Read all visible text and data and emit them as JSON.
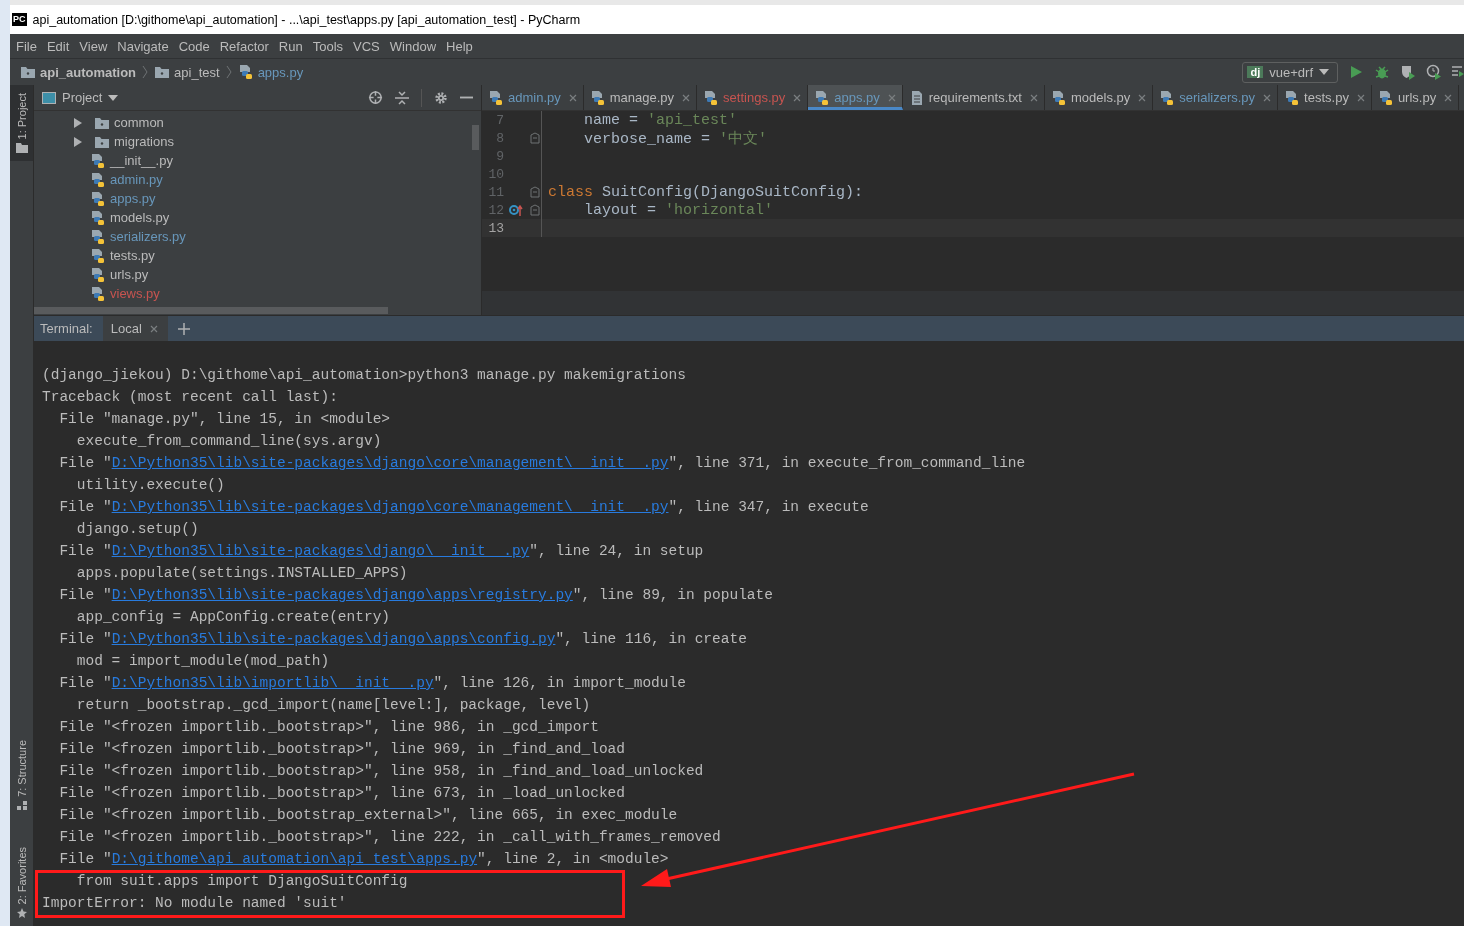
{
  "window": {
    "app_icon_text": "PC",
    "title": "api_automation [D:\\githome\\api_automation] - ...\\api_test\\apps.py [api_automation_test] - PyCharm"
  },
  "menu": [
    "File",
    "Edit",
    "View",
    "Navigate",
    "Code",
    "Refactor",
    "Run",
    "Tools",
    "VCS",
    "Window",
    "Help"
  ],
  "breadcrumb": [
    {
      "label": "api_automation",
      "kind": "folder"
    },
    {
      "label": "api_test",
      "kind": "folder"
    },
    {
      "label": "apps.py",
      "kind": "python"
    }
  ],
  "run_config": {
    "icon_text": "dj",
    "label": "vue+drf"
  },
  "tool_strip": {
    "top": [
      {
        "label": "1: Project",
        "selected": true
      }
    ],
    "bottom": [
      {
        "label": "7: Structure",
        "selected": false
      },
      {
        "label": "2: Favorites",
        "selected": false
      }
    ]
  },
  "project": {
    "title": "Project",
    "items": [
      {
        "name": "common",
        "kind": "folder",
        "expanded": false,
        "color": "#bbbbbb"
      },
      {
        "name": "migrations",
        "kind": "folder",
        "expanded": false,
        "color": "#bbbbbb"
      },
      {
        "name": "__init__.py",
        "kind": "python",
        "color": "#bbbbbb"
      },
      {
        "name": "admin.py",
        "kind": "python",
        "color": "#6897bb"
      },
      {
        "name": "apps.py",
        "kind": "python",
        "color": "#6897bb"
      },
      {
        "name": "models.py",
        "kind": "python",
        "color": "#bbbbbb"
      },
      {
        "name": "serializers.py",
        "kind": "python",
        "color": "#6897bb"
      },
      {
        "name": "tests.py",
        "kind": "python",
        "color": "#bbbbbb"
      },
      {
        "name": "urls.py",
        "kind": "python",
        "color": "#bbbbbb"
      },
      {
        "name": "views.py",
        "kind": "python",
        "color": "#c75450"
      }
    ]
  },
  "tabs": [
    {
      "label": "admin.py",
      "kind": "python",
      "selected": false,
      "color": "#6897bb"
    },
    {
      "label": "manage.py",
      "kind": "python",
      "selected": false,
      "color": "#bbbbbb"
    },
    {
      "label": "settings.py",
      "kind": "python",
      "selected": false,
      "color": "#c75450"
    },
    {
      "label": "apps.py",
      "kind": "python",
      "selected": true,
      "color": "#6897bb"
    },
    {
      "label": "requirements.txt",
      "kind": "text",
      "selected": false,
      "color": "#bbbbbb"
    },
    {
      "label": "models.py",
      "kind": "python",
      "selected": false,
      "color": "#bbbbbb"
    },
    {
      "label": "serializers.py",
      "kind": "python",
      "selected": false,
      "color": "#6897bb"
    },
    {
      "label": "tests.py",
      "kind": "python",
      "selected": false,
      "color": "#bbbbbb"
    },
    {
      "label": "urls.py",
      "kind": "python",
      "selected": false,
      "color": "#bbbbbb"
    }
  ],
  "editor": {
    "lines": [
      {
        "number": "7",
        "fold": false,
        "override": false,
        "current": false,
        "tokens": [
          {
            "kind": "plain",
            "text": "    name = "
          },
          {
            "kind": "string",
            "text": "'api_test'"
          }
        ]
      },
      {
        "number": "8",
        "fold": true,
        "override": false,
        "current": false,
        "tokens": [
          {
            "kind": "plain",
            "text": "    verbose_name = "
          },
          {
            "kind": "string",
            "text": "'中文'"
          }
        ]
      },
      {
        "number": "9",
        "fold": false,
        "override": false,
        "current": false
      },
      {
        "number": "10",
        "fold": false,
        "override": false,
        "current": false
      },
      {
        "number": "11",
        "fold": true,
        "override": false,
        "current": false,
        "tokens": [
          {
            "kind": "keyword",
            "text": "class"
          },
          {
            "kind": "plain",
            "text": " SuitConfig(DjangoSuitConfig):"
          }
        ]
      },
      {
        "number": "12",
        "fold": true,
        "override": true,
        "current": false,
        "tokens": [
          {
            "kind": "plain",
            "text": "    layout = "
          },
          {
            "kind": "string",
            "text": "'horizontal'"
          }
        ]
      },
      {
        "number": "13",
        "fold": false,
        "override": false,
        "current": true
      }
    ]
  },
  "terminal": {
    "label": "Terminal:",
    "tabs": [
      {
        "label": "Local"
      }
    ],
    "lines": [
      [
        {
          "kind": "text",
          "text": "(django_jiekou) D:\\githome\\api_automation>python3 manage.py makemigrations"
        }
      ],
      [
        {
          "kind": "text",
          "text": "Traceback (most recent call last):"
        }
      ],
      [
        {
          "kind": "text",
          "text": "  File \"manage.py\", line 15, in <module>"
        }
      ],
      [
        {
          "kind": "text",
          "text": "    execute_from_command_line(sys.argv)"
        }
      ],
      [
        {
          "kind": "text",
          "text": "  File \""
        },
        {
          "kind": "link",
          "text": "D:\\Python35\\lib\\site-packages\\django\\core\\management\\__init__.py"
        },
        {
          "kind": "text",
          "text": "\", line 371, in execute_from_command_line"
        }
      ],
      [
        {
          "kind": "text",
          "text": "    utility.execute()"
        }
      ],
      [
        {
          "kind": "text",
          "text": "  File \""
        },
        {
          "kind": "link",
          "text": "D:\\Python35\\lib\\site-packages\\django\\core\\management\\__init__.py"
        },
        {
          "kind": "text",
          "text": "\", line 347, in execute"
        }
      ],
      [
        {
          "kind": "text",
          "text": "    django.setup()"
        }
      ],
      [
        {
          "kind": "text",
          "text": "  File \""
        },
        {
          "kind": "link",
          "text": "D:\\Python35\\lib\\site-packages\\django\\__init__.py"
        },
        {
          "kind": "text",
          "text": "\", line 24, in setup"
        }
      ],
      [
        {
          "kind": "text",
          "text": "    apps.populate(settings.INSTALLED_APPS)"
        }
      ],
      [
        {
          "kind": "text",
          "text": "  File \""
        },
        {
          "kind": "link",
          "text": "D:\\Python35\\lib\\site-packages\\django\\apps\\registry.py"
        },
        {
          "kind": "text",
          "text": "\", line 89, in populate"
        }
      ],
      [
        {
          "kind": "text",
          "text": "    app_config = AppConfig.create(entry)"
        }
      ],
      [
        {
          "kind": "text",
          "text": "  File \""
        },
        {
          "kind": "link",
          "text": "D:\\Python35\\lib\\site-packages\\django\\apps\\config.py"
        },
        {
          "kind": "text",
          "text": "\", line 116, in create"
        }
      ],
      [
        {
          "kind": "text",
          "text": "    mod = import_module(mod_path)"
        }
      ],
      [
        {
          "kind": "text",
          "text": "  File \""
        },
        {
          "kind": "link",
          "text": "D:\\Python35\\lib\\importlib\\__init__.py"
        },
        {
          "kind": "text",
          "text": "\", line 126, in import_module"
        }
      ],
      [
        {
          "kind": "text",
          "text": "    return _bootstrap._gcd_import(name[level:], package, level)"
        }
      ],
      [
        {
          "kind": "text",
          "text": "  File \"<frozen importlib._bootstrap>\", line 986, in _gcd_import"
        }
      ],
      [
        {
          "kind": "text",
          "text": "  File \"<frozen importlib._bootstrap>\", line 969, in _find_and_load"
        }
      ],
      [
        {
          "kind": "text",
          "text": "  File \"<frozen importlib._bootstrap>\", line 958, in _find_and_load_unlocked"
        }
      ],
      [
        {
          "kind": "text",
          "text": "  File \"<frozen importlib._bootstrap>\", line 673, in _load_unlocked"
        }
      ],
      [
        {
          "kind": "text",
          "text": "  File \"<frozen importlib._bootstrap_external>\", line 665, in exec_module"
        }
      ],
      [
        {
          "kind": "text",
          "text": "  File \"<frozen importlib._bootstrap>\", line 222, in _call_with_frames_removed"
        }
      ],
      [
        {
          "kind": "text",
          "text": "  File \""
        },
        {
          "kind": "link",
          "text": "D:\\githome\\api_automation\\api_test\\apps.py"
        },
        {
          "kind": "text",
          "text": "\", line 2, in <module>"
        }
      ],
      [
        {
          "kind": "text",
          "text": "    from suit.apps import DjangoSuitConfig"
        }
      ],
      [
        {
          "kind": "text",
          "text": "ImportError: No module named 'suit'"
        }
      ]
    ]
  }
}
